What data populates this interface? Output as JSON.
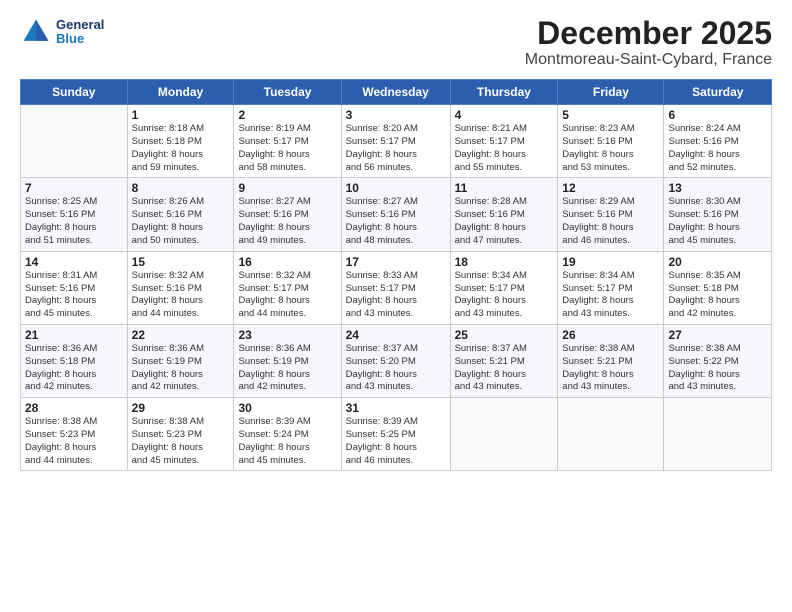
{
  "logo": {
    "line1": "General",
    "line2": "Blue"
  },
  "title": "December 2025",
  "subtitle": "Montmoreau-Saint-Cybard, France",
  "weekdays": [
    "Sunday",
    "Monday",
    "Tuesday",
    "Wednesday",
    "Thursday",
    "Friday",
    "Saturday"
  ],
  "weeks": [
    [
      {
        "day": "",
        "info": ""
      },
      {
        "day": "1",
        "info": "Sunrise: 8:18 AM\nSunset: 5:18 PM\nDaylight: 8 hours\nand 59 minutes."
      },
      {
        "day": "2",
        "info": "Sunrise: 8:19 AM\nSunset: 5:17 PM\nDaylight: 8 hours\nand 58 minutes."
      },
      {
        "day": "3",
        "info": "Sunrise: 8:20 AM\nSunset: 5:17 PM\nDaylight: 8 hours\nand 56 minutes."
      },
      {
        "day": "4",
        "info": "Sunrise: 8:21 AM\nSunset: 5:17 PM\nDaylight: 8 hours\nand 55 minutes."
      },
      {
        "day": "5",
        "info": "Sunrise: 8:23 AM\nSunset: 5:16 PM\nDaylight: 8 hours\nand 53 minutes."
      },
      {
        "day": "6",
        "info": "Sunrise: 8:24 AM\nSunset: 5:16 PM\nDaylight: 8 hours\nand 52 minutes."
      }
    ],
    [
      {
        "day": "7",
        "info": "Sunrise: 8:25 AM\nSunset: 5:16 PM\nDaylight: 8 hours\nand 51 minutes."
      },
      {
        "day": "8",
        "info": "Sunrise: 8:26 AM\nSunset: 5:16 PM\nDaylight: 8 hours\nand 50 minutes."
      },
      {
        "day": "9",
        "info": "Sunrise: 8:27 AM\nSunset: 5:16 PM\nDaylight: 8 hours\nand 49 minutes."
      },
      {
        "day": "10",
        "info": "Sunrise: 8:27 AM\nSunset: 5:16 PM\nDaylight: 8 hours\nand 48 minutes."
      },
      {
        "day": "11",
        "info": "Sunrise: 8:28 AM\nSunset: 5:16 PM\nDaylight: 8 hours\nand 47 minutes."
      },
      {
        "day": "12",
        "info": "Sunrise: 8:29 AM\nSunset: 5:16 PM\nDaylight: 8 hours\nand 46 minutes."
      },
      {
        "day": "13",
        "info": "Sunrise: 8:30 AM\nSunset: 5:16 PM\nDaylight: 8 hours\nand 45 minutes."
      }
    ],
    [
      {
        "day": "14",
        "info": "Sunrise: 8:31 AM\nSunset: 5:16 PM\nDaylight: 8 hours\nand 45 minutes."
      },
      {
        "day": "15",
        "info": "Sunrise: 8:32 AM\nSunset: 5:16 PM\nDaylight: 8 hours\nand 44 minutes."
      },
      {
        "day": "16",
        "info": "Sunrise: 8:32 AM\nSunset: 5:17 PM\nDaylight: 8 hours\nand 44 minutes."
      },
      {
        "day": "17",
        "info": "Sunrise: 8:33 AM\nSunset: 5:17 PM\nDaylight: 8 hours\nand 43 minutes."
      },
      {
        "day": "18",
        "info": "Sunrise: 8:34 AM\nSunset: 5:17 PM\nDaylight: 8 hours\nand 43 minutes."
      },
      {
        "day": "19",
        "info": "Sunrise: 8:34 AM\nSunset: 5:17 PM\nDaylight: 8 hours\nand 43 minutes."
      },
      {
        "day": "20",
        "info": "Sunrise: 8:35 AM\nSunset: 5:18 PM\nDaylight: 8 hours\nand 42 minutes."
      }
    ],
    [
      {
        "day": "21",
        "info": "Sunrise: 8:36 AM\nSunset: 5:18 PM\nDaylight: 8 hours\nand 42 minutes."
      },
      {
        "day": "22",
        "info": "Sunrise: 8:36 AM\nSunset: 5:19 PM\nDaylight: 8 hours\nand 42 minutes."
      },
      {
        "day": "23",
        "info": "Sunrise: 8:36 AM\nSunset: 5:19 PM\nDaylight: 8 hours\nand 42 minutes."
      },
      {
        "day": "24",
        "info": "Sunrise: 8:37 AM\nSunset: 5:20 PM\nDaylight: 8 hours\nand 43 minutes."
      },
      {
        "day": "25",
        "info": "Sunrise: 8:37 AM\nSunset: 5:21 PM\nDaylight: 8 hours\nand 43 minutes."
      },
      {
        "day": "26",
        "info": "Sunrise: 8:38 AM\nSunset: 5:21 PM\nDaylight: 8 hours\nand 43 minutes."
      },
      {
        "day": "27",
        "info": "Sunrise: 8:38 AM\nSunset: 5:22 PM\nDaylight: 8 hours\nand 43 minutes."
      }
    ],
    [
      {
        "day": "28",
        "info": "Sunrise: 8:38 AM\nSunset: 5:23 PM\nDaylight: 8 hours\nand 44 minutes."
      },
      {
        "day": "29",
        "info": "Sunrise: 8:38 AM\nSunset: 5:23 PM\nDaylight: 8 hours\nand 45 minutes."
      },
      {
        "day": "30",
        "info": "Sunrise: 8:39 AM\nSunset: 5:24 PM\nDaylight: 8 hours\nand 45 minutes."
      },
      {
        "day": "31",
        "info": "Sunrise: 8:39 AM\nSunset: 5:25 PM\nDaylight: 8 hours\nand 46 minutes."
      },
      {
        "day": "",
        "info": ""
      },
      {
        "day": "",
        "info": ""
      },
      {
        "day": "",
        "info": ""
      }
    ]
  ]
}
